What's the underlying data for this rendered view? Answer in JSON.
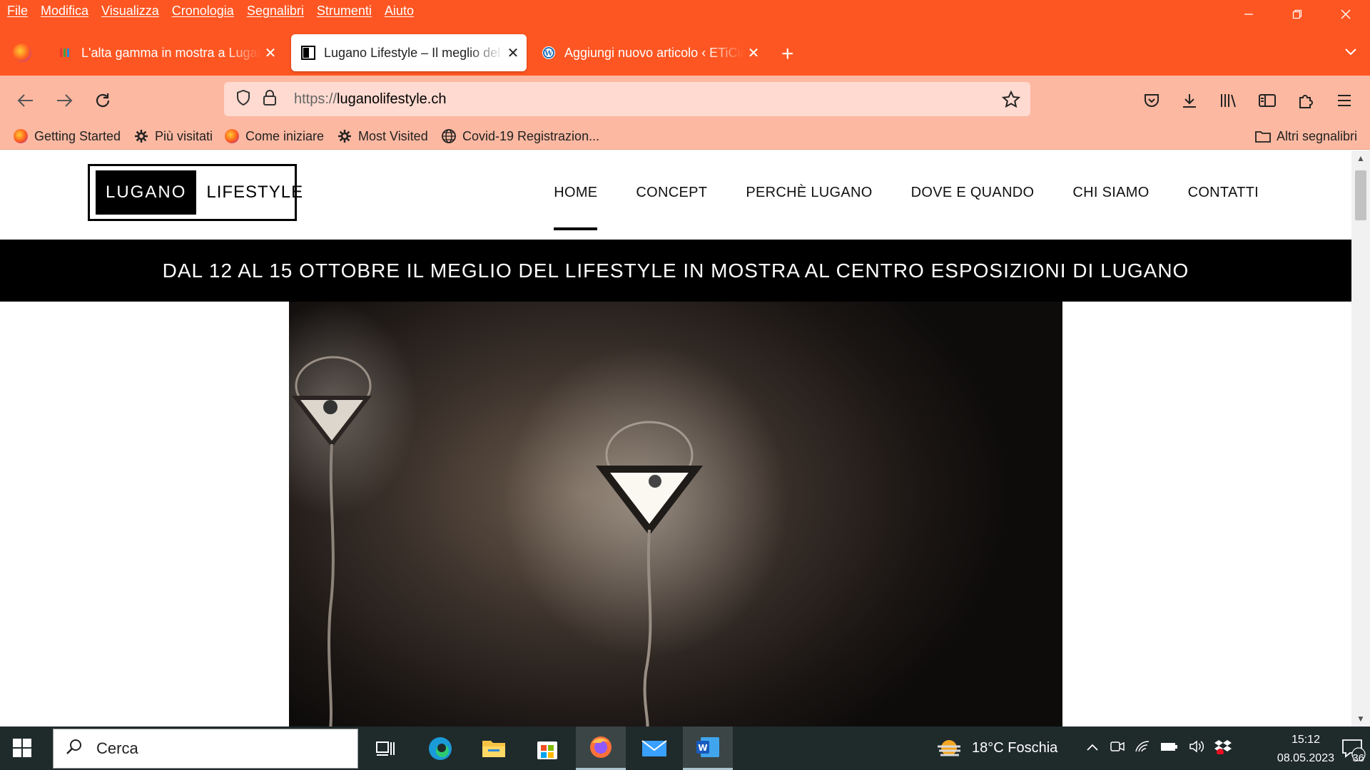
{
  "menu": [
    "File",
    "Modifica",
    "Visualizza",
    "Cronologia",
    "Segnalibri",
    "Strumenti",
    "Aiuto"
  ],
  "tabs": [
    {
      "title": "L'alta gamma in mostra a Lugano",
      "active": false
    },
    {
      "title": "Lugano Lifestyle – Il meglio del lifestyle",
      "active": true
    },
    {
      "title": "Aggiungi nuovo articolo ‹ ETiCinfo",
      "active": false
    }
  ],
  "url": {
    "protocol": "https://",
    "host": "luganolifestyle.ch"
  },
  "bookmarks": [
    "Getting Started",
    "Più visitati",
    "Come iniziare",
    "Most Visited",
    "Covid-19 Registrazion..."
  ],
  "other_bookmarks": "Altri segnalibri",
  "site": {
    "logo_left": "LUGANO",
    "logo_right": "LIFESTYLE",
    "nav": [
      "HOME",
      "CONCEPT",
      "PERCHÈ LUGANO",
      "DOVE E QUANDO",
      "CHI SIAMO",
      "CONTATTI"
    ],
    "banner": "DAL 12 AL 15 OTTOBRE IL MEGLIO DEL LIFESTYLE IN MOSTRA AL CENTRO ESPOSIZIONI DI LUGANO"
  },
  "taskbar": {
    "search_placeholder": "Cerca",
    "weather": "18°C  Foschia",
    "time": "15:12",
    "date": "08.05.2023",
    "notifications": "36"
  },
  "colors": {
    "firefox_orange": "#fe5622",
    "toolbar": "#fcb8a1",
    "taskbar": "#1f2a2b"
  }
}
